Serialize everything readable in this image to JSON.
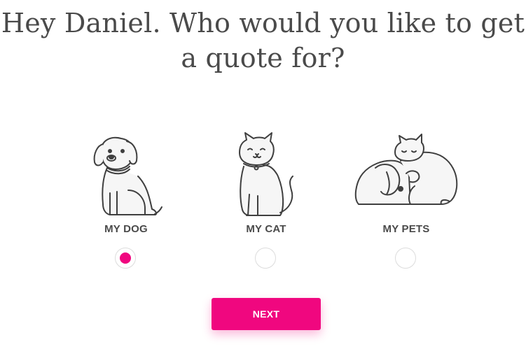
{
  "heading": "Hey Daniel. Who would you like to get a quote for?",
  "options": [
    {
      "label": "MY DOG",
      "selected": true,
      "icon": "dog-icon"
    },
    {
      "label": "MY CAT",
      "selected": false,
      "icon": "cat-icon"
    },
    {
      "label": "MY PETS",
      "selected": false,
      "icon": "pets-icon"
    }
  ],
  "next_label": "NEXT",
  "colors": {
    "accent": "#f0077f",
    "text": "#4a4a4a",
    "radio_border": "#dcdcdc"
  }
}
